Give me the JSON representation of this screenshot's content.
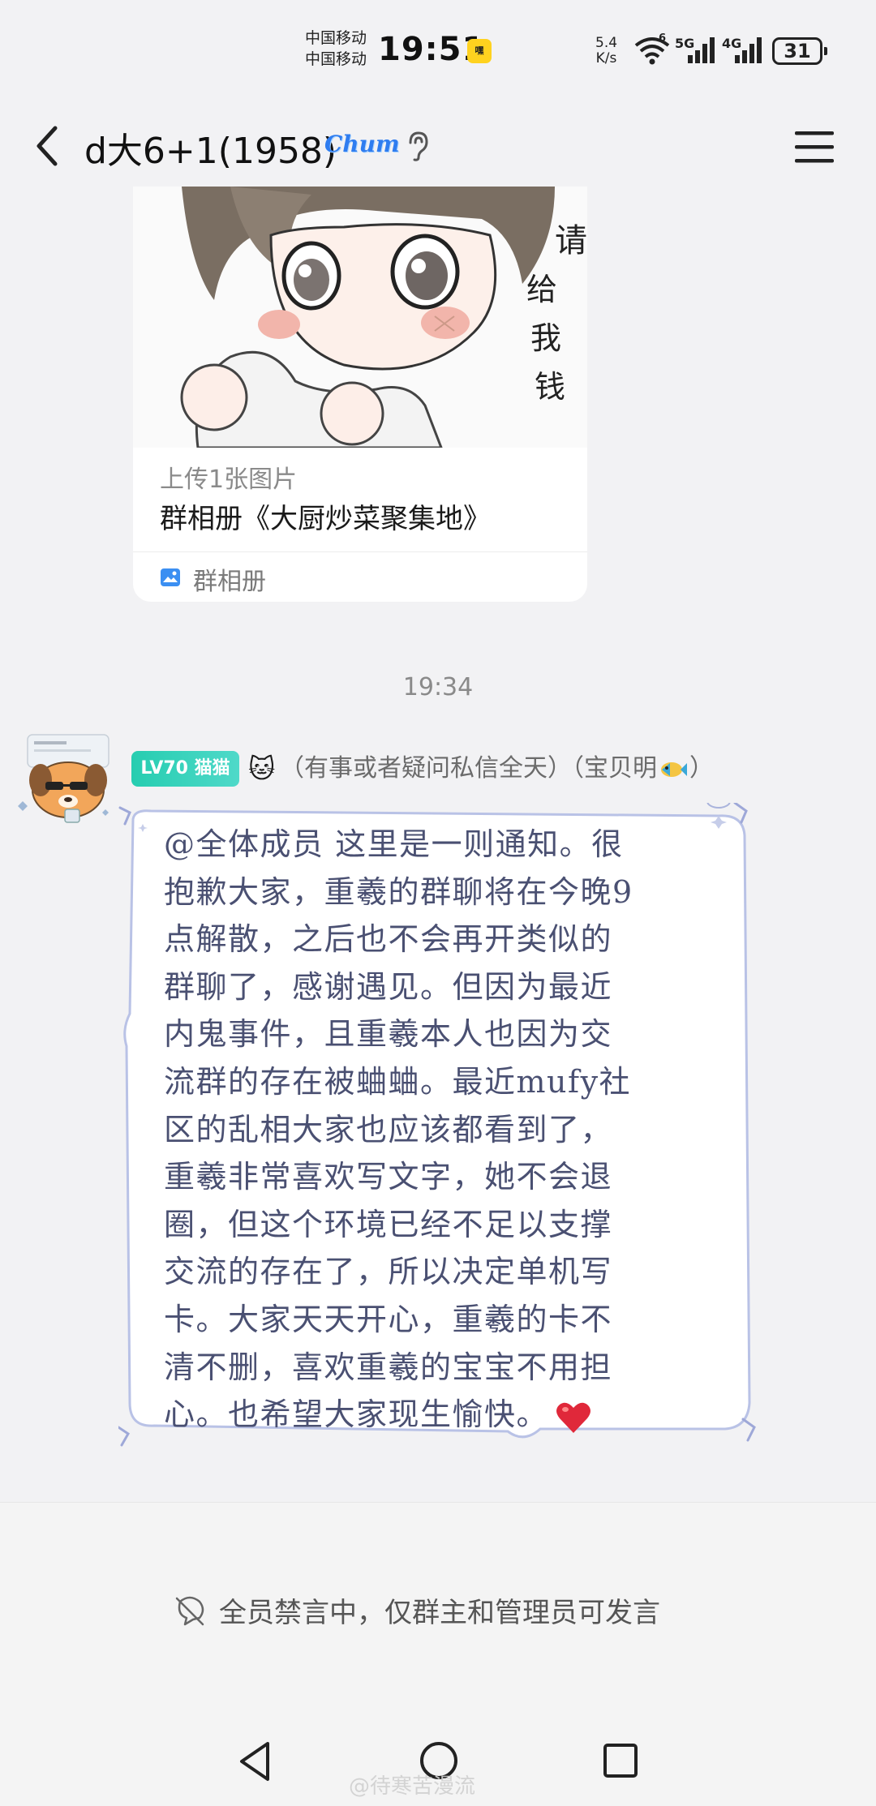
{
  "status": {
    "carrier1": "中国移动",
    "carrier2": "中国移动",
    "time": "19:51",
    "app_badge": "嘿",
    "net_speed_value": "5.4",
    "net_speed_unit": "K/s",
    "wifi_sup": "6",
    "sig_5g": "5G",
    "sig_4g": "4G",
    "battery": "31"
  },
  "header": {
    "title": "d大6+1(1958)",
    "vip_badge": "Chum"
  },
  "album_card": {
    "upload_text": "上传1张图片",
    "album_name": "群相册《大厨炒菜聚集地》",
    "footer_label": "群相册",
    "image_caption": "请给我钱"
  },
  "time_divider": "19:34",
  "message": {
    "level_badge": "LV70 猫猫",
    "sender_name": "（有事或者疑问私信全天）（宝贝明",
    "sender_name_end": "）",
    "lines": [
      "@全体成员 这里是一则通知。很",
      "抱歉大家，重羲的群聊将在今晚9",
      "点解散，之后也不会再开类似的",
      "群聊了，感谢遇见。但因为最近",
      "内鬼事件，且重羲本人也因为交",
      "流群的存在被蛐蛐。最近mufy社",
      "区的乱相大家也应该都看到了，",
      "重羲非常喜欢写文字，她不会退",
      "圈，但这个环境已经不足以支撑",
      "交流的存在了，所以决定单机写",
      "卡。大家天天开心，重羲的卡不",
      "清不删，喜欢重羲的宝宝不用担",
      "心。也希望大家现生愉快。"
    ]
  },
  "mute_notice": "全员禁言中，仅群主和管理员可发言",
  "watermark": "@待寒苦漫流",
  "colors": {
    "level_badge": "#26cdb0",
    "bubble_text": "#4a5072",
    "page_bg": "#f2f2f4"
  }
}
